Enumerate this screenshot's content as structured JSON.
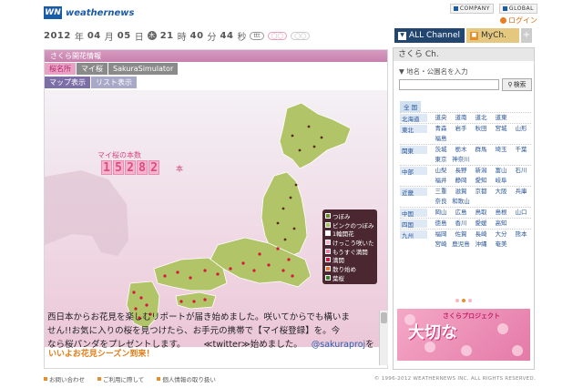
{
  "header": {
    "logo_mark": "WN",
    "logo_text": "weathernews",
    "links": [
      "COMPANY",
      "GLOBAL"
    ],
    "login": "ログイン"
  },
  "datebar": {
    "year": "2012",
    "year_unit": "年",
    "month": "04",
    "month_unit": "月",
    "day": "05",
    "day_unit": "日",
    "weekday": "木",
    "hour": "21",
    "hour_unit": "時",
    "minute": "40",
    "minute_unit": "分",
    "second": "44",
    "second_unit": "秒",
    "pills": [
      "ttt",
      "◯◯",
      "◯◯"
    ]
  },
  "tabs": {
    "all": "ALL Channel",
    "my": "MyCh.",
    "plus": "+"
  },
  "main": {
    "title": "さくら開花情報",
    "nav": [
      "桜名所",
      "マイ桜",
      "SakuraSimulator"
    ],
    "views": [
      "マップ表示",
      "リスト表示"
    ],
    "count_label": "マイ桜の本数",
    "count_digits": [
      "1",
      "5",
      "2",
      "8",
      "2"
    ],
    "count_unit": "本"
  },
  "legend": [
    {
      "label": "つぼみ",
      "color": "#6b8a2a"
    },
    {
      "label": "ピンクのつぼみ",
      "color": "#a9c15a"
    },
    {
      "label": "1輪開花",
      "color": "#ffffff"
    },
    {
      "label": "けっこう咲いた",
      "color": "#f7b3cb"
    },
    {
      "label": "もうすぐ満開",
      "color": "#f07da8"
    },
    {
      "label": "満開",
      "color": "#d9133e"
    },
    {
      "label": "散り始め",
      "color": "#f26c2c"
    },
    {
      "label": "葉桜",
      "color": "#3a7d2a"
    }
  ],
  "news": {
    "title": "いいよお花見シーズン到来！",
    "line1": "西日本からお花見を楽しむリポートが届き始めました。咲いてからでも構いま",
    "line2": "せん!!お気に入りの桜を見つけたら、お手元の携帯で【マイ桜登録】を。今",
    "line3_a": "なら桜パンダをプレゼントします。",
    "line3_b": "≪twitter≫始めました。",
    "line3_c": "@sakuraproj",
    "line3_d": "を"
  },
  "side": {
    "title": "さくら Ch.",
    "search_label": "地名・公園名を入力",
    "search_placeholder": "",
    "search_button": "検索",
    "all_regions": "全 国",
    "regions": [
      {
        "name": "北海道",
        "prefs": [
          "道央",
          "道南",
          "道北",
          "道東"
        ]
      },
      {
        "name": "東北",
        "prefs": [
          "青森",
          "岩手",
          "秋田",
          "宮城",
          "山形",
          "福島"
        ]
      },
      {
        "name": "関東",
        "prefs": [
          "茨城",
          "栃木",
          "群馬",
          "埼玉",
          "千葉",
          "東京",
          "神奈川"
        ]
      },
      {
        "name": "中部",
        "prefs": [
          "山梨",
          "長野",
          "新潟",
          "富山",
          "石川",
          "福井",
          "静岡",
          "愛知",
          "岐阜"
        ]
      },
      {
        "name": "近畿",
        "prefs": [
          "三重",
          "滋賀",
          "京都",
          "大阪",
          "兵庫",
          "奈良",
          "和歌山"
        ]
      },
      {
        "name": "中国",
        "prefs": [
          "岡山",
          "広島",
          "鳥取",
          "島根",
          "山口"
        ]
      },
      {
        "name": "四国",
        "prefs": [
          "徳島",
          "香川",
          "愛媛",
          "高知"
        ]
      },
      {
        "name": "九州",
        "prefs": [
          "福岡",
          "佐賀",
          "長崎",
          "大分",
          "熊本",
          "宮崎",
          "鹿児島",
          "沖縄",
          "奄美"
        ]
      }
    ],
    "promo_title": "さくらプロジェクト",
    "promo_big": "大切な"
  },
  "footer": {
    "links": [
      "お問い合わせ",
      "ご利用に際して",
      "個人情報の取り扱い"
    ],
    "copyright": "© 1996-2012 WEATHERNEWS INC. ALL RIGHTS RESERVED."
  },
  "colors": {
    "brand_blue": "#1a5ba8",
    "sakura_pink": "#e9a2c4",
    "accent_orange": "#e58e2a"
  }
}
